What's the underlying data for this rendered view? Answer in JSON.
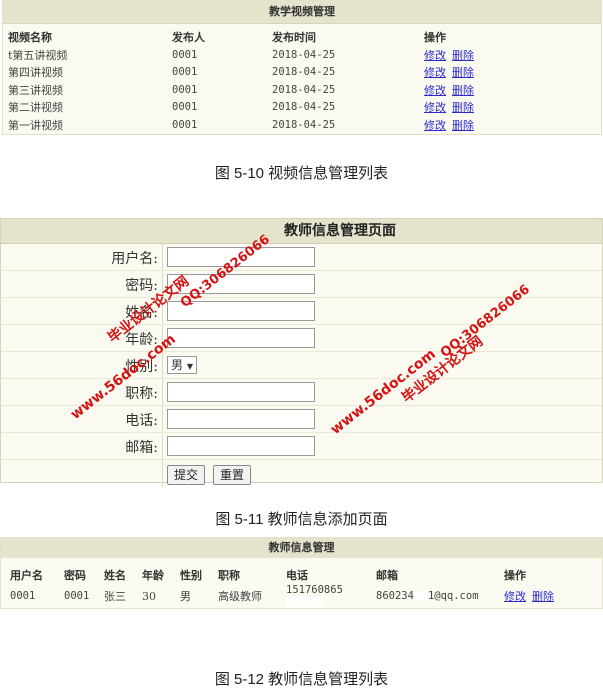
{
  "video_list": {
    "title": "教学视频管理",
    "headers": [
      "视频名称",
      "发布人",
      "发布时间",
      "操作"
    ],
    "rows": [
      {
        "name": "t第五讲视频",
        "publisher": "0001",
        "date": "2018-04-25"
      },
      {
        "name": "第四讲视频",
        "publisher": "0001",
        "date": "2018-04-25"
      },
      {
        "name": "第三讲视频",
        "publisher": "0001",
        "date": "2018-04-25"
      },
      {
        "name": "第二讲视频",
        "publisher": "0001",
        "date": "2018-04-25"
      },
      {
        "name": "第一讲视频",
        "publisher": "0001",
        "date": "2018-04-25"
      }
    ],
    "edit_label": "修改",
    "delete_label": "删除"
  },
  "caption1": "图 5-10 视频信息管理列表",
  "teacher_form": {
    "title": "教师信息管理页面",
    "fields": {
      "username": "用户名:",
      "password": "密码:",
      "name": "姓名:",
      "age": "年龄:",
      "gender": "性别:",
      "title": "职称:",
      "phone": "电话:",
      "email": "邮箱:"
    },
    "gender_value": "男",
    "submit_label": "提交",
    "reset_label": "重置"
  },
  "watermark": {
    "site": "www.56doc.com",
    "qq": "QQ:306826066",
    "name": "毕业设计论文网"
  },
  "caption2": "图 5-11 教师信息添加页面",
  "teacher_list": {
    "title": "教师信息管理",
    "headers": [
      "用户名",
      "密码",
      "姓名",
      "年龄",
      "性别",
      "职称",
      "电话",
      "邮箱",
      "操作"
    ],
    "row": {
      "username": "0001",
      "password": "0001",
      "name": "张三",
      "age": "30",
      "gender": "男",
      "title": "高级教师",
      "phone": "151760865",
      "email_start": "860234",
      "email_end": "1@qq.com"
    },
    "edit_label": "修改",
    "delete_label": "删除"
  },
  "caption3": "图 5-12 教师信息管理列表",
  "colors": {
    "link": "#2b2bcc",
    "header_bg": "#e6e3cc",
    "panel_bg": "#fbfaf0",
    "watermark": "#d41414"
  }
}
